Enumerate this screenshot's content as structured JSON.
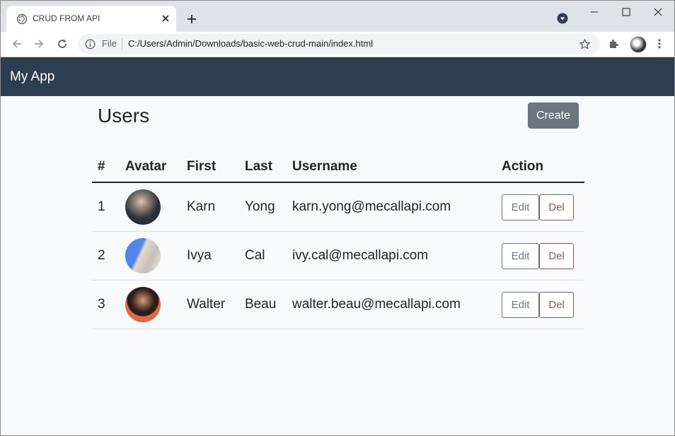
{
  "browser": {
    "tab_title": "CRUD FROM API",
    "omnibox": {
      "scheme": "File",
      "url": "C:/Users/Admin/Downloads/basic-web-crud-main/index.html"
    }
  },
  "navbar": {
    "brand": "My App"
  },
  "page": {
    "title": "Users",
    "create_label": "Create"
  },
  "table": {
    "headers": {
      "num": "#",
      "avatar": "Avatar",
      "first": "First",
      "last": "Last",
      "username": "Username",
      "action": "Action"
    },
    "rows": [
      {
        "num": "1",
        "first": "Karn",
        "last": "Yong",
        "username": "karn.yong@mecallapi.com",
        "edit": "Edit",
        "del": "Del"
      },
      {
        "num": "2",
        "first": "Ivya",
        "last": "Cal",
        "username": "ivy.cal@mecallapi.com",
        "edit": "Edit",
        "del": "Del"
      },
      {
        "num": "3",
        "first": "Walter",
        "last": "Beau",
        "username": "walter.beau@mecallapi.com",
        "edit": "Edit",
        "del": "Del"
      }
    ]
  },
  "colors": {
    "navbar_bg": "#2c3e50",
    "create_button_bg": "#6c757d",
    "edit_outline": "#6c757d",
    "delete_outline": "#8e5a50",
    "page_bg": "#f8f9fa"
  },
  "icons": {
    "favicon": "globe-icon",
    "tab_close": "close-icon",
    "new_tab": "plus-icon",
    "profile_menu": "profile-dropdown-icon",
    "back": "arrow-left-icon",
    "forward": "arrow-right-icon",
    "reload": "reload-icon",
    "site_info": "info-icon",
    "bookmark": "star-icon",
    "extensions": "puzzle-icon",
    "browser_menu": "kebab-menu-icon"
  }
}
